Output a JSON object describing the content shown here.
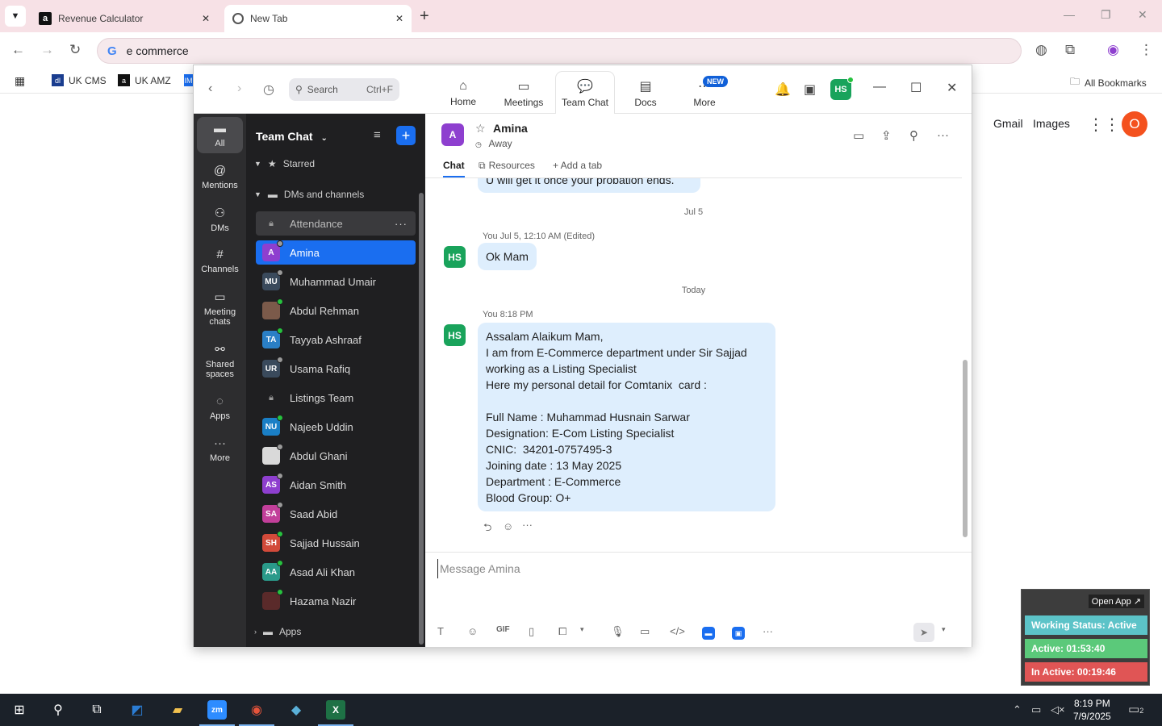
{
  "browser": {
    "tabs": [
      {
        "title": "Revenue Calculator",
        "favicon": "a"
      },
      {
        "title": "New Tab",
        "favicon": "globe"
      }
    ],
    "address": "e commerce",
    "bookmarks": [
      {
        "label": "UK CMS",
        "color": "#1a3d8f"
      },
      {
        "label": "UK AMZ",
        "color": "#111111"
      },
      {
        "label": "IM",
        "color": "#1a6ef0"
      }
    ],
    "all_bookmarks": "All Bookmarks",
    "google_links": {
      "gmail": "Gmail",
      "images": "Images",
      "avatar": "O"
    }
  },
  "zoom": {
    "search": {
      "placeholder": "Search",
      "shortcut": "Ctrl+F"
    },
    "nav_tabs": [
      {
        "label": "Home",
        "icon": "home-icon"
      },
      {
        "label": "Meetings",
        "icon": "video-icon"
      },
      {
        "label": "Team Chat",
        "icon": "chat-icon"
      },
      {
        "label": "Docs",
        "icon": "doc-icon"
      },
      {
        "label": "More",
        "icon": "more-icon"
      }
    ],
    "new_badge": "NEW",
    "user_avatar": "HS",
    "rail": [
      {
        "label": "All"
      },
      {
        "label": "Mentions"
      },
      {
        "label": "DMs"
      },
      {
        "label": "Channels"
      },
      {
        "label": "Meeting chats"
      },
      {
        "label": "Shared spaces"
      },
      {
        "label": "Apps"
      },
      {
        "label": "More"
      }
    ],
    "sidebar": {
      "title": "Team Chat",
      "sections": {
        "starred": "Starred",
        "dms": "DMs and channels",
        "apps": "Apps"
      },
      "items": [
        {
          "name": "Attendance",
          "type": "channel"
        },
        {
          "name": "Amina",
          "initials": "A",
          "color": "#8e3fcf",
          "status": "#9a9a9a"
        },
        {
          "name": "Muhammad Umair",
          "initials": "MU",
          "color": "#3a4a5c",
          "status": "#9a9a9a"
        },
        {
          "name": "Abdul Rehman",
          "initials": "",
          "color": "#7b5a4a",
          "status": "#26c23e"
        },
        {
          "name": "Tayyab Ashraaf",
          "initials": "TA",
          "color": "#2a7fc6",
          "status": "#26c23e"
        },
        {
          "name": "Usama Rafiq",
          "initials": "UR",
          "color": "#3a4a5c",
          "status": "#9a9a9a"
        },
        {
          "name": "Listings Team",
          "type": "channel"
        },
        {
          "name": "Najeeb Uddin",
          "initials": "NU",
          "color": "#1a7fc6",
          "status": "#26c23e"
        },
        {
          "name": "Abdul Ghani",
          "initials": "",
          "color": "#d9d9d9",
          "status": "#9a9a9a"
        },
        {
          "name": "Aidan Smith",
          "initials": "AS",
          "color": "#8e3fcf",
          "status": "#9a9a9a"
        },
        {
          "name": "Saad Abid",
          "initials": "SA",
          "color": "#c23f9a",
          "status": "#9a9a9a"
        },
        {
          "name": "Sajjad Hussain",
          "initials": "SH",
          "color": "#d24a3a",
          "status": "#26c23e"
        },
        {
          "name": "Asad Ali Khan",
          "initials": "AA",
          "color": "#2a9a8a",
          "status": "#26c23e"
        },
        {
          "name": "Hazama Nazir",
          "initials": "",
          "color": "#5a2a2a",
          "status": "#26c23e"
        }
      ]
    },
    "chat": {
      "contact": "Amina",
      "contact_initial": "A",
      "status": "Away",
      "tabs": [
        "Chat",
        "Resources",
        "+ Add a tab"
      ],
      "prev_message": "U will get it once your probation ends.",
      "date1": "Jul 5",
      "msg1": {
        "avatar": "HS",
        "meta": "You Jul 5, 12:10 AM (Edited)",
        "text": "Ok Mam"
      },
      "date2": "Today",
      "msg2": {
        "avatar": "HS",
        "meta": "You 8:18 PM",
        "lines": [
          "Assalam Alaikum Mam,",
          "I am from E-Commerce department under Sir Sajjad",
          "working as a Listing Specialist",
          "Here my personal detail for Comtanix  card :",
          "",
          "Full Name : Muhammad Husnain Sarwar",
          "Designation: E-Com Listing Specialist",
          "CNIC:  34201-0757495-3",
          "Joining date : 13 May 2025",
          "Department : E-Commerce",
          "Blood Group: O+"
        ]
      },
      "composer_placeholder": "Message Amina"
    }
  },
  "widget": {
    "open_app": "Open App ↗",
    "working_status": "Working Status: Active",
    "active": "Active: 01:53:40",
    "inactive": "In Active: 00:19:46"
  },
  "taskbar": {
    "time": "8:19 PM",
    "date": "7/9/2025",
    "notifications": "2"
  }
}
